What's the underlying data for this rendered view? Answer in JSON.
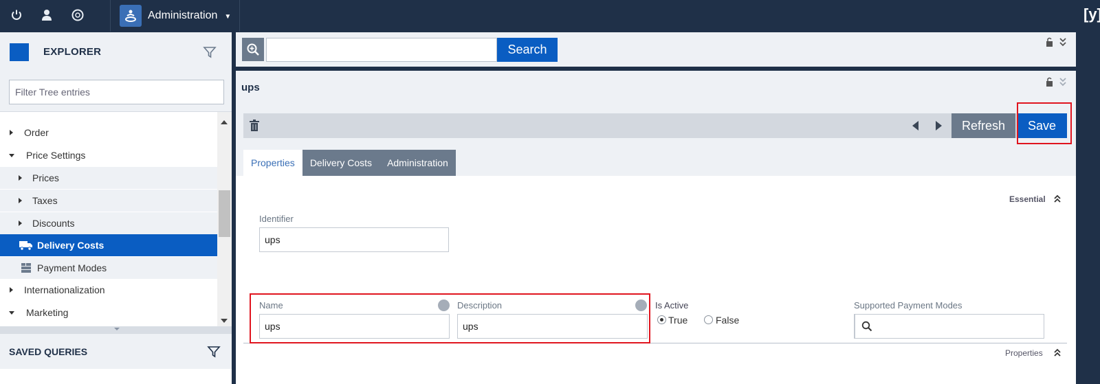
{
  "topbar": {
    "icons": [
      "power-icon",
      "user-icon",
      "globe-icon"
    ],
    "app_name": "Administration",
    "brand_glyph": "[y]"
  },
  "explorer": {
    "title": "EXPLORER",
    "filter_placeholder": "Filter Tree entries",
    "tree": [
      {
        "label": "Order",
        "expander": "collapsed",
        "level": 0
      },
      {
        "label": "Price Settings",
        "expander": "expanded",
        "level": 0
      },
      {
        "label": "Prices",
        "expander": "collapsed",
        "level": 1
      },
      {
        "label": "Taxes",
        "expander": "collapsed",
        "level": 1
      },
      {
        "label": "Discounts",
        "expander": "collapsed",
        "level": 1
      },
      {
        "label": "Delivery Costs",
        "expander": "none",
        "level": 1,
        "icon": "truck-icon",
        "selected": true
      },
      {
        "label": "Payment Modes",
        "expander": "none",
        "level": 1,
        "icon": "payment-modes-icon"
      },
      {
        "label": "Internationalization",
        "expander": "collapsed",
        "level": 0
      },
      {
        "label": "Marketing",
        "expander": "expanded",
        "level": 0
      }
    ]
  },
  "saved_queries": {
    "title": "SAVED QUERIES"
  },
  "search": {
    "button_label": "Search",
    "query": ""
  },
  "editor": {
    "title": "ups",
    "refresh_label": "Refresh",
    "save_label": "Save",
    "tabs": [
      {
        "label": "Properties",
        "active": true
      },
      {
        "label": "Delivery Costs",
        "active": false
      },
      {
        "label": "Administration",
        "active": false
      }
    ],
    "essential": {
      "section_label": "Essential",
      "identifier_label": "Identifier",
      "identifier_value": "ups"
    },
    "properties": {
      "section_label": "Properties",
      "name_label": "Name",
      "name_value": "ups",
      "description_label": "Description",
      "description_value": "ups",
      "is_active_label": "Is Active",
      "true_label": "True",
      "false_label": "False",
      "is_active_value": "True",
      "payment_modes_label": "Supported Payment Modes",
      "payment_modes_value": ""
    }
  },
  "colors": {
    "accent": "#0a5dc2",
    "nav_bg": "#1f3048",
    "panel_bg": "#eef1f5",
    "gray_button": "#6b7a8c",
    "highlight": "#e0141e"
  }
}
